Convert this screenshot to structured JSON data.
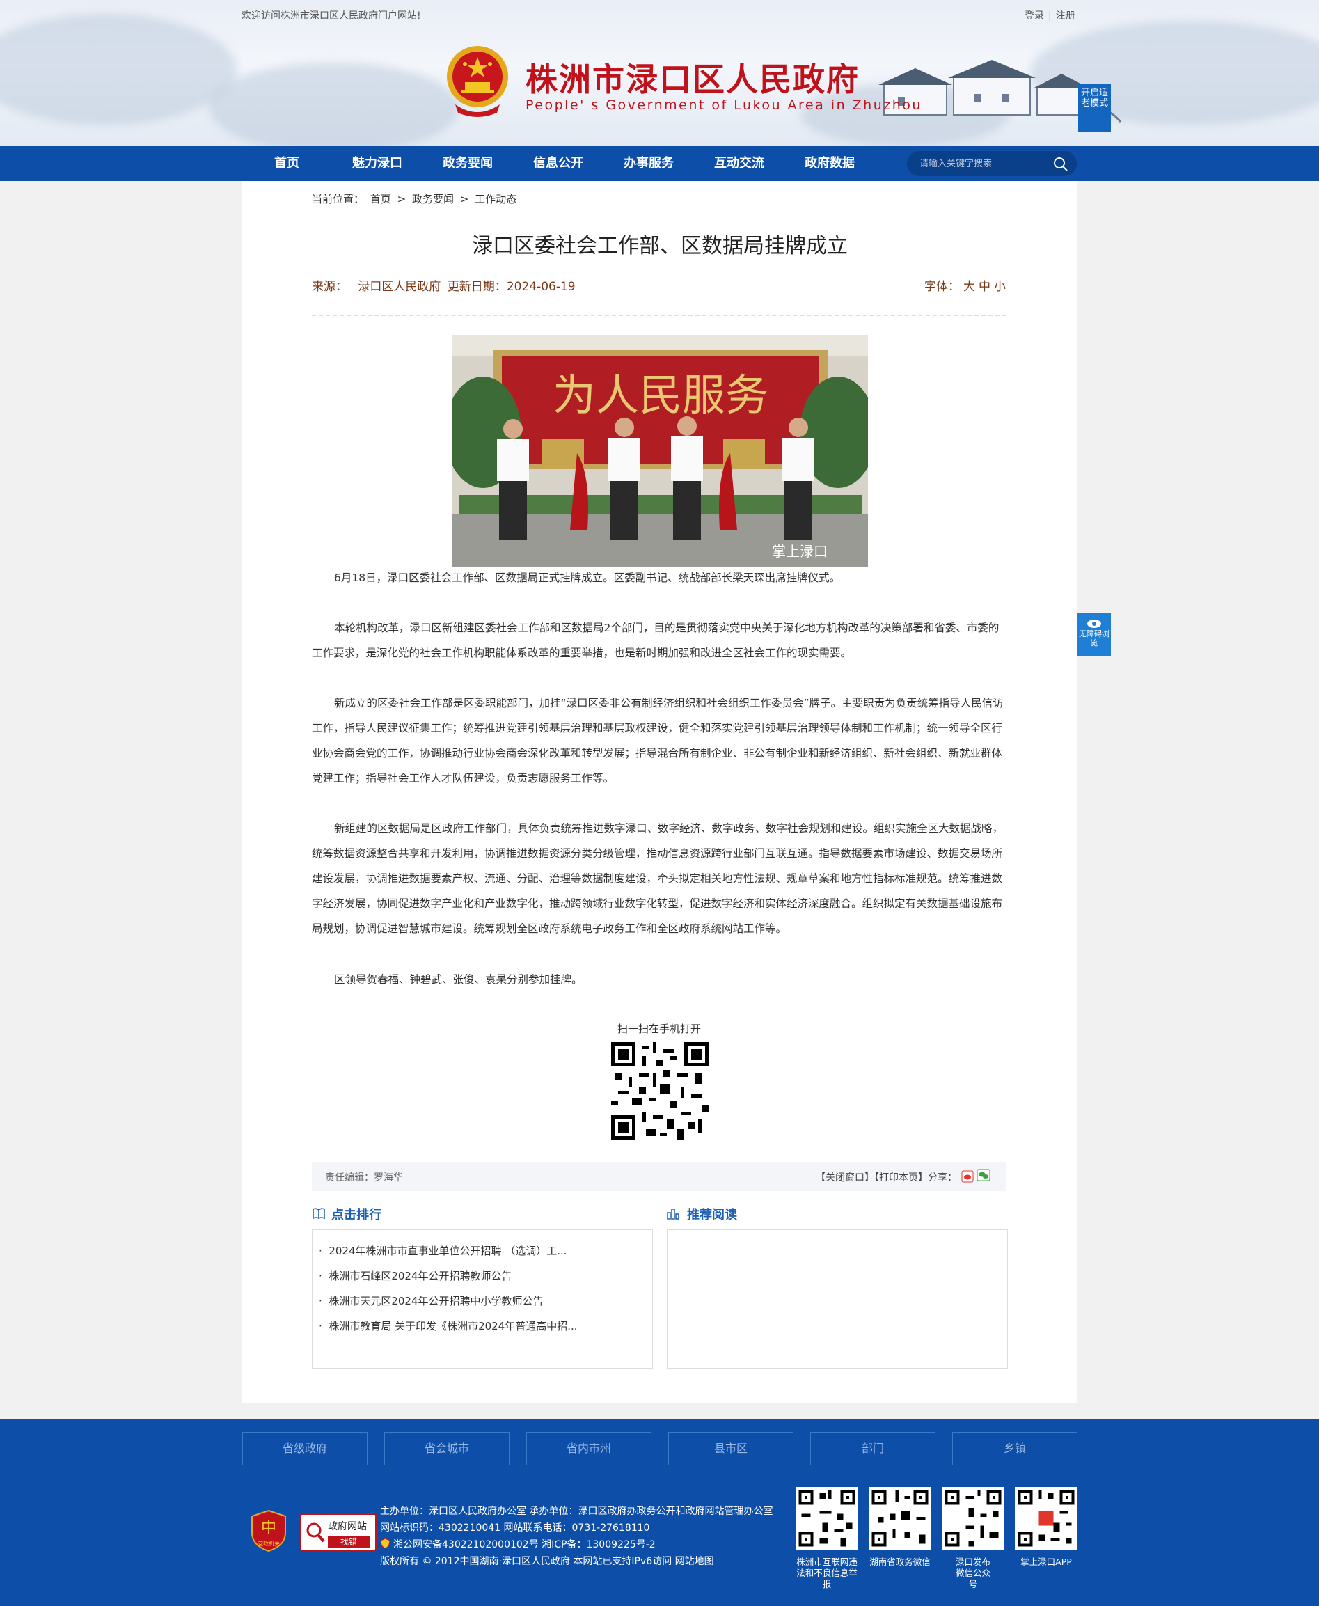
{
  "topbar": {
    "welcome": "欢迎访问株洲市渌口区人民政府门户网站!",
    "login": "登录",
    "register": "注册"
  },
  "header": {
    "title": "株洲市渌口区人民政府",
    "subtitle": "People' s Government of Lukou Area in Zhuzhou",
    "elder_mode": "开启适老模式"
  },
  "nav": {
    "items": [
      "首页",
      "魅力渌口",
      "政务要闻",
      "信息公开",
      "办事服务",
      "互动交流",
      "政府数据"
    ],
    "search_placeholder": "请输入关键字搜索"
  },
  "breadcrumb": {
    "label": "当前位置：",
    "items": [
      "首页",
      ">",
      "政务要闻",
      ">",
      "工作动态"
    ]
  },
  "article": {
    "title": "渌口区委社会工作部、区数据局挂牌成立",
    "source_label": "来源：",
    "source": "渌口区人民政府",
    "date_label": "更新日期：",
    "date": "2024-06-19",
    "font_label": "字体：",
    "font_sizes": [
      "大",
      "中",
      "小"
    ],
    "photo_watermark": "掌上渌口",
    "paragraphs": [
      "6月18日，渌口区委社会工作部、区数据局正式挂牌成立。区委副书记、统战部部长梁天琛出席挂牌仪式。",
      "本轮机构改革，渌口区新组建区委社会工作部和区数据局2个部门，目的是贯彻落实党中央关于深化地方机构改革的决策部署和省委、市委的工作要求，是深化党的社会工作机构职能体系改革的重要举措，也是新时期加强和改进全区社会工作的现实需要。",
      "新成立的区委社会工作部是区委职能部门，加挂“渌口区委非公有制经济组织和社会组织工作委员会”牌子。主要职责为负责统筹指导人民信访工作，指导人民建议征集工作；统筹推进党建引领基层治理和基层政权建设，健全和落实党建引领基层治理领导体制和工作机制；统一领导全区行业协会商会党的工作，协调推动行业协会商会深化改革和转型发展；指导混合所有制企业、非公有制企业和新经济组织、新社会组织、新就业群体党建工作；指导社会工作人才队伍建设，负责志愿服务工作等。",
      "新组建的区数据局是区政府工作部门，具体负责统筹推进数字渌口、数字经济、数字政务、数字社会规划和建设。组织实施全区大数据战略，统筹数据资源整合共享和开发利用，协调推进数据资源分类分级管理，推动信息资源跨行业部门互联互通。指导数据要素市场建设、数据交易场所建设发展，协调推进数据要素产权、流通、分配、治理等数据制度建设，牵头拟定相关地方性法规、规章草案和地方性指标标准规范。统筹推进数字经济发展，协同促进数字产业化和产业数字化，推动跨领域行业数字化转型，促进数字经济和实体经济深度融合。组织拟定有关数据基础设施布局规划，协调促进智慧城市建设。统筹规划全区政府系统电子政务工作和全区政府系统网站工作等。",
      "区领导贺春福、钟碧武、张俊、袁杲分别参加挂牌。"
    ],
    "qr_label": "扫一扫在手机打开",
    "editor_label": "责任编辑：",
    "editor": "罗海华",
    "close_window": "【关闭窗口】",
    "print_page": "【打印本页】",
    "share_label": "分享："
  },
  "hot": {
    "title": "点击排行",
    "items": [
      "2024年株洲市市直事业单位公开招聘 （选调）工...",
      "株洲市石峰区2024年公开招聘教师公告",
      "株洲市天元区2024年公开招聘中小学教师公告",
      "株洲市教育局 关于印发《株洲市2024年普通高中招..."
    ]
  },
  "recommend": {
    "title": "推荐阅读"
  },
  "barrier_free": "无障碍浏览",
  "footer": {
    "links": [
      "省级政府",
      "省会城市",
      "省内市州",
      "县市区",
      "部门",
      "乡镇"
    ],
    "badge_gov": "党政机关",
    "badge_find_title": "政府网站",
    "badge_find_btn": "找错",
    "lines": [
      "主办单位：渌口区人民政府办公室 承办单位：渌口区政府办政务公开和政府网站管理办公室",
      "网站标识码：4302210041 网站联系电话：0731-27618110",
      "湘公网安备43022102000102号 湘ICP备：13009225号-2",
      "版权所有 © 2012中国湖南·渌口区人民政府 本网站已支持IPv6访问 网站地图"
    ],
    "qrs": [
      "株洲市互联网违法和不良信息举报",
      "湖南省政务微信",
      "渌口发布微信公众号",
      "掌上渌口APP"
    ]
  },
  "colors": {
    "nav": "#0d4fa8",
    "title_red": "#c0121a",
    "accent_blue": "#1d5fb5"
  }
}
